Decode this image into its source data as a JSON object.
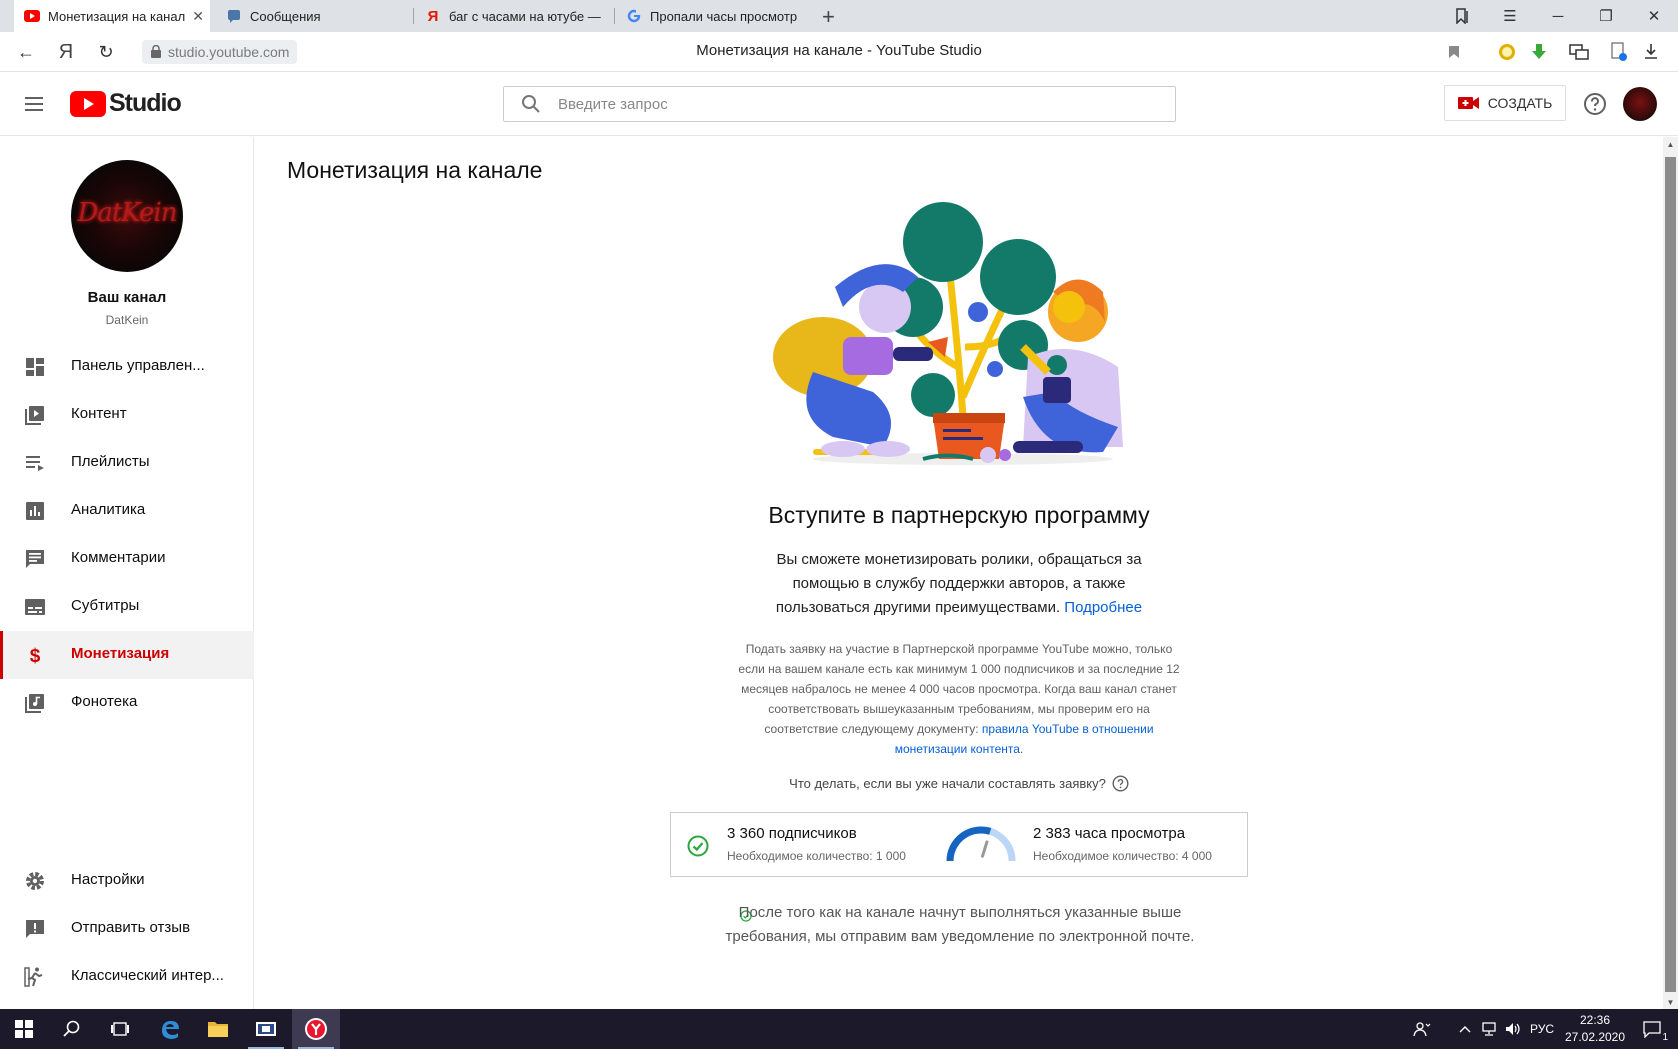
{
  "browser": {
    "tabs": [
      {
        "title": "Монетизация на канал",
        "icon": "youtube-icon",
        "active": true
      },
      {
        "title": "Сообщения",
        "icon": "messages-icon",
        "active": false
      },
      {
        "title": "баг с часами на ютубе —",
        "icon": "yandex-icon",
        "active": false
      },
      {
        "title": "Пропали часы просмотр",
        "icon": "google-icon",
        "active": false
      }
    ],
    "new_tab_label": "+",
    "url": "studio.youtube.com",
    "page_title": "Монетизация на канале - YouTube Studio",
    "yandex_letter": "Я"
  },
  "header": {
    "logo_text": "Studio",
    "search_placeholder": "Введите запрос",
    "create_label": "СОЗДАТЬ"
  },
  "sidebar": {
    "channel_title": "Ваш канал",
    "channel_name": "DatKein",
    "avatar_text": "DatKein",
    "items": [
      {
        "label": "Панель управлен...",
        "icon": "dashboard-icon"
      },
      {
        "label": "Контент",
        "icon": "video-library-icon"
      },
      {
        "label": "Плейлисты",
        "icon": "playlist-icon"
      },
      {
        "label": "Аналитика",
        "icon": "analytics-icon"
      },
      {
        "label": "Комментарии",
        "icon": "comments-icon"
      },
      {
        "label": "Субтитры",
        "icon": "subtitles-icon"
      },
      {
        "label": "Монетизация",
        "icon": "dollar-icon",
        "active": true
      },
      {
        "label": "Фонотека",
        "icon": "audio-library-icon"
      }
    ],
    "bottom_items": [
      {
        "label": "Настройки",
        "icon": "gear-icon"
      },
      {
        "label": "Отправить отзыв",
        "icon": "feedback-icon"
      },
      {
        "label": "Классический интер...",
        "icon": "classic-exit-icon"
      }
    ]
  },
  "main": {
    "title": "Монетизация на канале",
    "join_title": "Вступите в партнерскую программу",
    "join_desc": "Вы сможете монетизировать ролики, обращаться за помощью в службу поддержки авторов, а также пользоваться другими преимуществами.",
    "join_link": "Подробнее",
    "fine_print": "Подать заявку на участие в Партнерской программе YouTube можно, только если на вашем канале есть как минимум 1 000 подписчиков и за последние 12 месяцев набралось не менее 4 000 часов просмотра. Когда ваш канал станет соответствовать вышеуказанным требованиям, мы проверим его на соответствие следующему документу:",
    "fine_print_link": "правила YouTube в отношении монетизации контента",
    "fine_print_end": ".",
    "faq": "Что делать, если вы уже начали составлять заявку?",
    "stats": {
      "subscribers_label": "3 360 подписчиков",
      "subscribers_required": "Необходимое количество: 1 000",
      "subscribers_done": true,
      "watch_label": "2 383 часа просмотра",
      "watch_required": "Необходимое количество: 4 000",
      "watch_progress": 0.596
    },
    "notify": "После того как на канале начнут выполняться указанные выше требования, мы отправим вам уведомление по электронной почте."
  },
  "taskbar": {
    "lang": "РУС",
    "time": "22:36",
    "date": "27.02.2020",
    "notifications_count": "1"
  },
  "colors": {
    "brand_red": "#cc0000",
    "link_blue": "#065fd4",
    "success_green": "#2ba640",
    "gauge_blue": "#1565c0"
  }
}
